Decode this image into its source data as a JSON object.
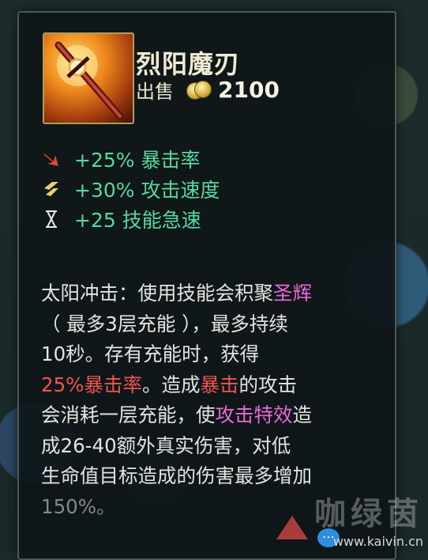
{
  "item": {
    "name": "烈阳魔刃",
    "sell_label": "出售",
    "sell_price": "2100",
    "icon": "sun-blade-icon"
  },
  "stats": [
    {
      "icon": "crit-arrow-icon",
      "text": "+25% 暴击率"
    },
    {
      "icon": "attack-speed-icon",
      "text": "+30% 攻击速度"
    },
    {
      "icon": "hourglass-icon",
      "text": "+25 技能急速"
    }
  ],
  "description": {
    "line1_a": "太阳冲击：使用技能会积聚",
    "line1_kw": "圣辉",
    "line2": "（ 最多3层充能 ），最多持续",
    "line3": "10秒。存有充能时，获得",
    "line4_kw": "25%暴击率",
    "line4_b": "。造成",
    "line4_kw2": "暴击",
    "line4_c": "的攻击",
    "line5_a": "会消耗一层充能，使",
    "line5_kw": "攻击特效",
    "line5_b": "造",
    "line6": "成26-40额外真实伤害，对低",
    "line7": "生命值目标造成的伤害最多增加",
    "line8": "150%。"
  },
  "watermark": {
    "chars": "咖绿茵",
    "url": "www.kaivin.cn"
  },
  "colors": {
    "stat_green": "#57d9a0",
    "keyword_purple": "#e86ad6",
    "keyword_red": "#f0554c"
  }
}
